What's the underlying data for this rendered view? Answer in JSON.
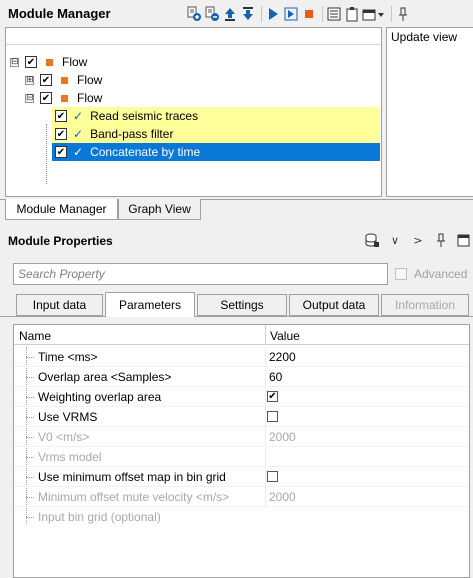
{
  "module_manager": {
    "title": "Module Manager",
    "toolbar_icons": [
      "add-module-icon",
      "remove-module-icon",
      "move-up-icon",
      "move-down-icon",
      "run-icon",
      "run-step-icon",
      "stop-icon",
      "list-icon",
      "clipboard-icon",
      "window-dropdown-icon",
      "pin-icon"
    ],
    "tree": [
      {
        "label": "Flow",
        "expander": "⊟",
        "checked": true,
        "level": 0
      },
      {
        "label": "Flow",
        "expander": "⊞",
        "checked": true,
        "level": 1
      },
      {
        "label": "Flow",
        "expander": "⊟",
        "checked": true,
        "level": 1
      },
      {
        "label": "Read seismic traces",
        "checked": true,
        "status": "✓",
        "level": 2,
        "highlight": "yellow"
      },
      {
        "label": "Band-pass filter",
        "checked": true,
        "status": "✓",
        "level": 2,
        "highlight": "yellow"
      },
      {
        "label": "Concatenate by time",
        "checked": true,
        "status": "✓",
        "level": 2,
        "highlight": "blue"
      }
    ],
    "side_panel_label": "Update view",
    "bottom_tabs": [
      "Module Manager",
      "Graph View"
    ]
  },
  "module_properties": {
    "title": "Module Properties",
    "search_placeholder": "Search Property",
    "advanced_label": "Advanced",
    "tabs": [
      "Input data",
      "Parameters",
      "Settings",
      "Output data",
      "Information"
    ],
    "active_tab": "Parameters",
    "columns": {
      "name": "Name",
      "value": "Value"
    },
    "rows": [
      {
        "name": "Time <ms>",
        "value": "2200",
        "type": "text",
        "enabled": true
      },
      {
        "name": "Overlap area <Samples>",
        "value": "60",
        "type": "text",
        "enabled": true
      },
      {
        "name": "Weighting overlap area",
        "value": "✔",
        "type": "checkbox",
        "checked": true,
        "enabled": true
      },
      {
        "name": "Use VRMS",
        "value": "",
        "type": "checkbox",
        "checked": false,
        "enabled": true
      },
      {
        "name": "V0 <m/s>",
        "value": "2000",
        "type": "text",
        "enabled": false
      },
      {
        "name": "Vrms model",
        "value": "",
        "type": "text",
        "enabled": false
      },
      {
        "name": "Use minimum offset map in bin grid",
        "value": "",
        "type": "checkbox",
        "checked": false,
        "enabled": true
      },
      {
        "name": "Minimum offset mute velocity <m/s>",
        "value": "2000",
        "type": "text",
        "enabled": false
      },
      {
        "name": "Input bin grid (optional)",
        "value": "",
        "type": "text",
        "enabled": false
      }
    ]
  }
}
